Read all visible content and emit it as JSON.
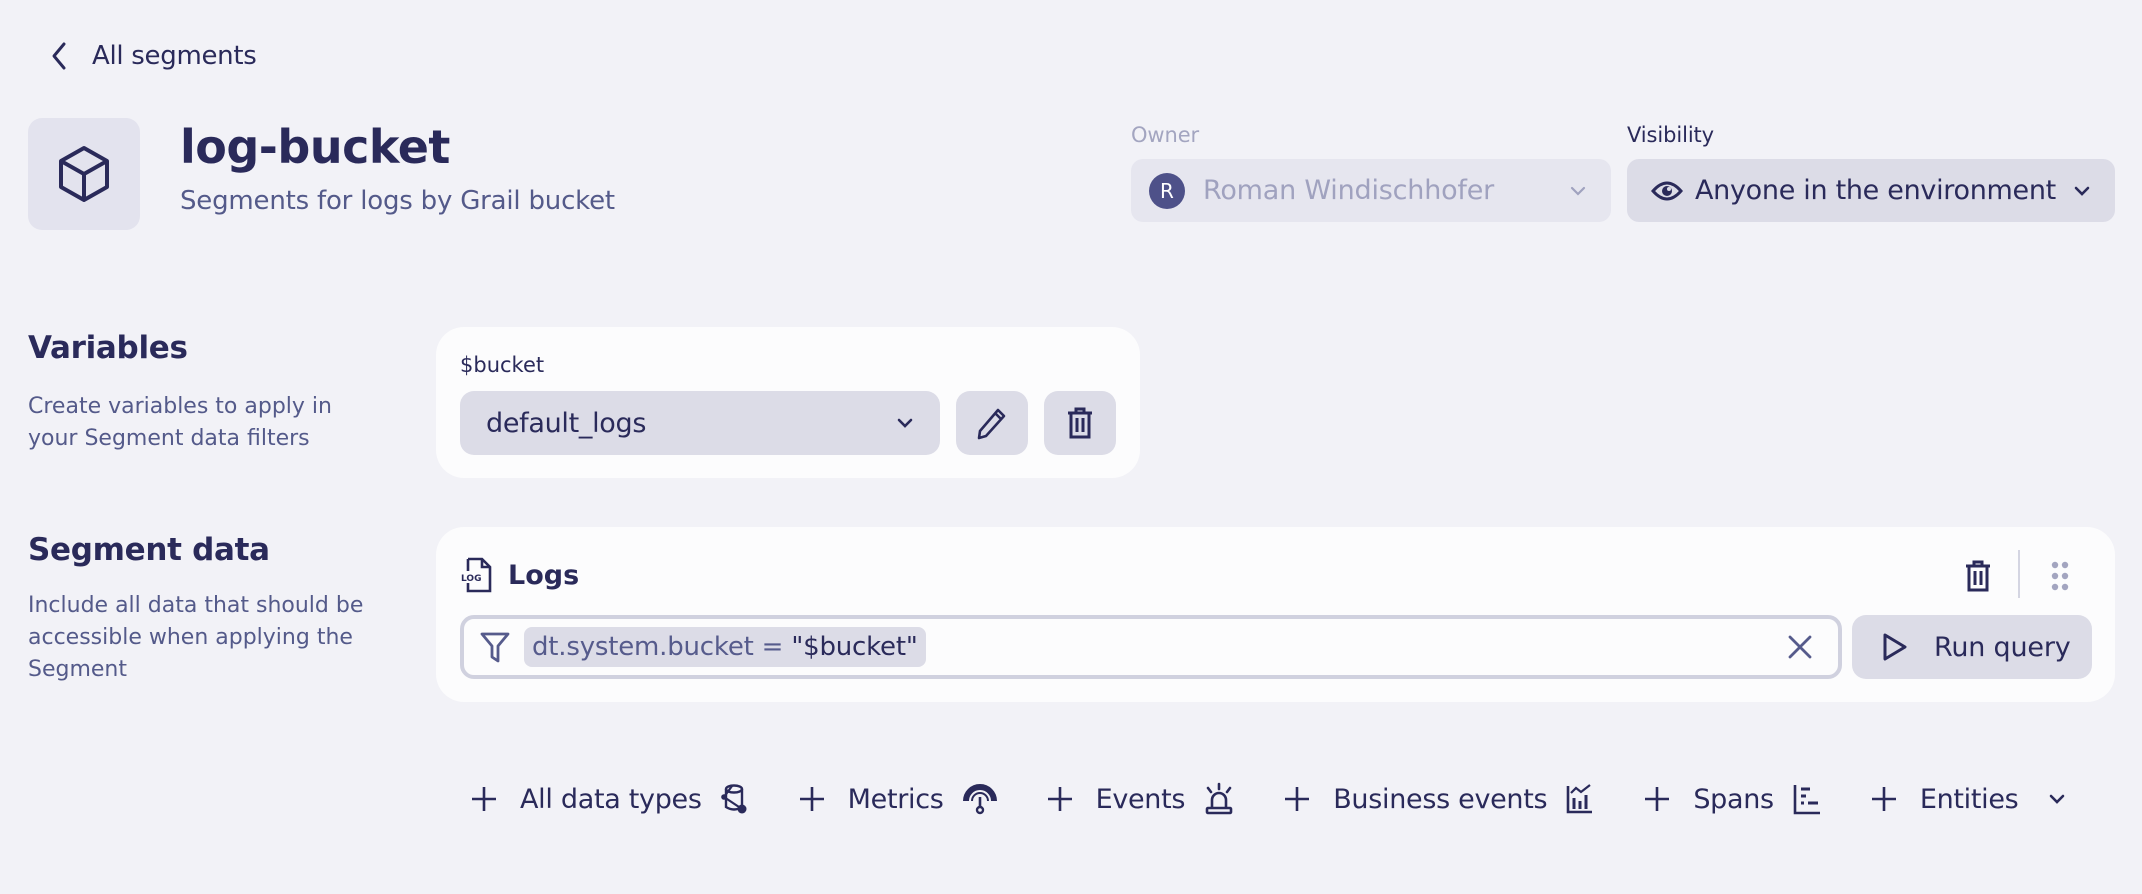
{
  "nav": {
    "back_label": "All segments"
  },
  "segment": {
    "title": "log-bucket",
    "subtitle": "Segments for logs by Grail bucket",
    "icon": "cube-icon"
  },
  "owner": {
    "label": "Owner",
    "avatar_initial": "R",
    "value": "Roman Windischhofer",
    "disabled": true
  },
  "visibility": {
    "label": "Visibility",
    "value": "Anyone in the environment",
    "icon": "eye-icon"
  },
  "variables": {
    "title": "Variables",
    "description": "Create variables to apply in your Segment data filters",
    "items": [
      {
        "name": "$bucket",
        "value": "default_logs"
      }
    ]
  },
  "segment_data": {
    "title": "Segment data",
    "description": "Include all data that should be accessible when applying the Segment",
    "blocks": [
      {
        "type_label": "Logs",
        "icon": "log-file-icon",
        "filter": {
          "key": "dt.system.bucket = ",
          "value": "\"$bucket\""
        },
        "run_label": "Run query"
      }
    ]
  },
  "add_buttons": [
    {
      "label": "All data types",
      "icon": "all-data-types-icon"
    },
    {
      "label": "Metrics",
      "icon": "metrics-gauge-icon"
    },
    {
      "label": "Events",
      "icon": "events-alarm-icon"
    },
    {
      "label": "Business events",
      "icon": "business-events-chart-icon"
    },
    {
      "label": "Spans",
      "icon": "spans-icon"
    },
    {
      "label": "Entities",
      "icon": "chevron-down-icon"
    }
  ],
  "colors": {
    "background": "#f2f2f7",
    "card": "#fcfcfd",
    "control": "#dcdce7",
    "text_primary": "#2a2a5a",
    "text_secondary": "#545a8a",
    "text_disabled": "#a0a2bf",
    "avatar": "#4e5189"
  }
}
